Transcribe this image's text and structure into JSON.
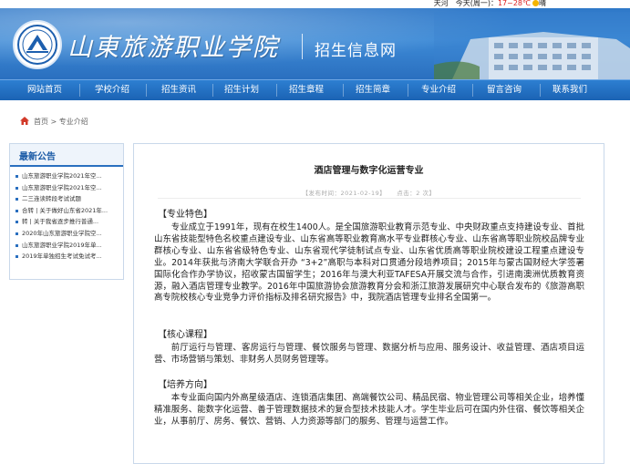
{
  "weather": {
    "text": "天河　今天(周一)：",
    "temp": "17~28℃",
    "condition": "晴",
    "icon": "sun-icon"
  },
  "banner": {
    "school_name": "山東旅游职业学院",
    "site_title": "招生信息网",
    "logo": "school-emblem"
  },
  "nav": {
    "items": [
      "网站首页",
      "学校介绍",
      "招生资讯",
      "招生计划",
      "招生章程",
      "招生简章",
      "专业介绍",
      "留言咨询",
      "联系我们"
    ]
  },
  "breadcrumb": {
    "home": "首页",
    "sep": ">",
    "current": "专业介绍"
  },
  "sidebar": {
    "title": "最新公告",
    "items": [
      "山东旅游职业学院2021年空...",
      "山东旅游职业学院2021年空...",
      "二三连读转段考试试题",
      "合转 | 关于做好山东省2021年...",
      "转 | 关于我省逐步推行普通...",
      "2020年山东旅游职业学院空...",
      "山东旅游职业学院2019年单...",
      "2019年单独招生考试免试考..."
    ]
  },
  "article": {
    "title": "酒店管理与数字化运营专业",
    "meta_date": "【发布时间：2021-02-19】",
    "meta_clicks": "点击：2 次",
    "meta_close": "】",
    "sections": [
      {
        "heading": "【专业特色】",
        "body": "专业成立于1991年，现有在校生1400人。是全国旅游职业教育示范专业、中央财政重点支持建设专业、首批山东省技能型特色名校重点建设专业、山东省高等职业教育高水平专业群核心专业、山东省高等职业院校品牌专业群核心专业、山东省省级特色专业、山东省现代学徒制试点专业、山东省优质高等职业院校建设工程重点建设专业。2014年获批与济南大学联合开办 “3+2”高职与本科对口贯通分段培养项目；2015年与蒙古国财经大学签署国际化合作办学协议，招收蒙古国留学生；2016年与澳大利亚TAFESA开展交流与合作，引进南澳洲优质教育资源，融入酒店管理专业教学。2016年中国旅游协会旅游教育分会和浙江旅游发展研究中心联合发布的《旅游高职高专院校核心专业竞争力评价指标及排名研究报告》中，我院酒店管理专业排名全国第一。"
      },
      {
        "heading": "【核心课程】",
        "body": "前厅运行与管理、客房运行与管理、餐饮服务与管理、数据分析与应用、服务设计、收益管理、酒店项目运营、市场营销与策划、非财务人员财务管理等。"
      },
      {
        "heading": "【培养方向】",
        "body": "本专业面向国内外高星级酒店、连锁酒店集团、高端餐饮公司、精品民宿、物业管理公司等相关企业，培养懂精准服务、能数字化运营、善于管理数据技术的复合型技术技能人才。学生毕业后可在国内外住宿、餐饮等相关企业，从事前厅、房务、餐饮、营销、人力资源等部门的服务、管理与运营工作。"
      }
    ]
  },
  "colors": {
    "brand_blue": "#2a6fbf",
    "nav_blue": "#1b63b4",
    "accent_red": "#d22222"
  }
}
